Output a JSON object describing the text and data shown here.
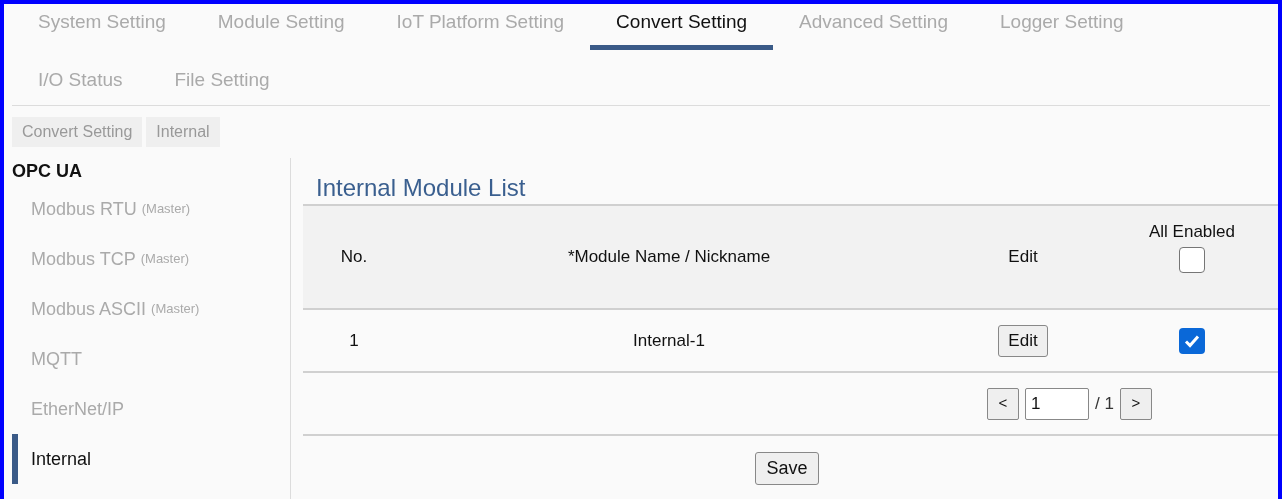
{
  "tabs": [
    {
      "label": "System Setting",
      "selected": false
    },
    {
      "label": "Module Setting",
      "selected": false
    },
    {
      "label": "IoT Platform Setting",
      "selected": false
    },
    {
      "label": "Convert Setting",
      "selected": true
    },
    {
      "label": "Advanced Setting",
      "selected": false
    },
    {
      "label": "Logger Setting",
      "selected": false
    },
    {
      "label": "I/O Status",
      "selected": false
    },
    {
      "label": "File Setting",
      "selected": false
    }
  ],
  "breadcrumb": [
    "Convert Setting",
    "Internal"
  ],
  "sidebar": {
    "heading": "OPC UA",
    "items": [
      {
        "label": "Modbus RTU",
        "note": "(Master)",
        "selected": false
      },
      {
        "label": "Modbus TCP",
        "note": "(Master)",
        "selected": false
      },
      {
        "label": "Modbus ASCII",
        "note": "(Master)",
        "selected": false
      },
      {
        "label": "MQTT",
        "selected": false
      },
      {
        "label": "EtherNet/IP",
        "selected": false
      },
      {
        "label": "Internal",
        "selected": true
      }
    ]
  },
  "main": {
    "title": "Internal Module List",
    "table": {
      "columns": [
        "No.",
        "*Module Name / Nickname",
        "Edit",
        "All Enabled"
      ],
      "all_enabled_checked": false,
      "rows": [
        {
          "no": "1",
          "name": "Internal-1",
          "edit": "Edit",
          "checked": true
        }
      ]
    },
    "pagination": {
      "prev": "<",
      "page": "1",
      "total": "/ 1",
      "next": ">"
    },
    "save": "Save"
  }
}
